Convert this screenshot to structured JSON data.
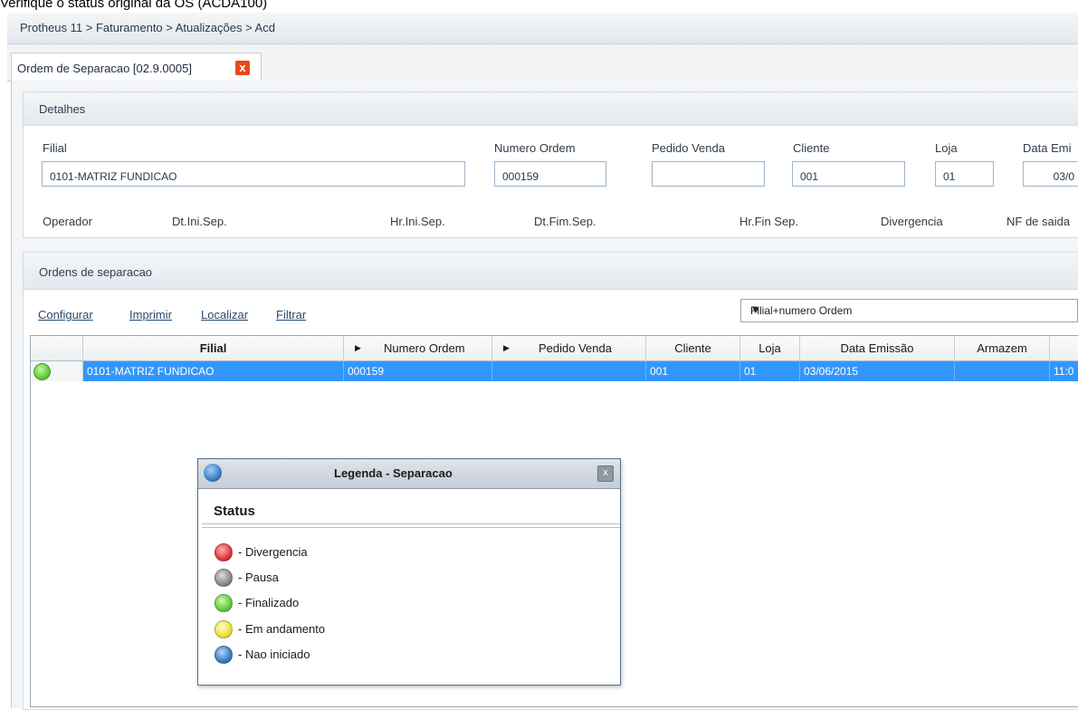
{
  "caption": "Verifique o status original da OS (ACDA100)",
  "breadcrumb": "Protheus 11 > Faturamento > Atualizações > Acd",
  "tab": {
    "label": "Ordem de Separacao [02.9.0005]",
    "close": "x"
  },
  "details": {
    "title": "Detalhes",
    "fields": {
      "filial": {
        "label": "Filial",
        "value": "0101-MATRIZ FUNDICAO"
      },
      "numero_ordem": {
        "label": "Numero Ordem",
        "value": "000159"
      },
      "pedido_venda": {
        "label": "Pedido Venda",
        "value": ""
      },
      "cliente": {
        "label": "Cliente",
        "value": "001"
      },
      "loja": {
        "label": "Loja",
        "value": "01"
      },
      "data_emissao": {
        "label": "Data Emi",
        "value": "03/0"
      }
    },
    "labels_row2": [
      "Operador",
      "Dt.Ini.Sep.",
      "Hr.Ini.Sep.",
      "Dt.Fim.Sep.",
      "Hr.Fin Sep.",
      "Divergencia",
      "NF de saida"
    ]
  },
  "orders": {
    "title": "Ordens de separacao",
    "actions": {
      "configurar": "Configurar",
      "imprimir": "Imprimir",
      "localizar": "Localizar",
      "filtrar": "Filtrar"
    },
    "index_select": {
      "value": "Filial+numero Ordem"
    },
    "columns": [
      "",
      "Filial",
      "Numero Ordem",
      "Pedido Venda",
      "Cliente",
      "Loja",
      "Data Emissão",
      "Armazem",
      ""
    ],
    "rows": [
      {
        "status": "green",
        "filial": "0101-MATRIZ FUNDICAO",
        "numero_ordem": "000159",
        "pedido_venda": "",
        "cliente": "001",
        "loja": "01",
        "data_emissao": "03/06/2015",
        "armazem": "",
        "hora": "11:0"
      }
    ]
  },
  "legend_dialog": {
    "title": "Legenda - Separacao",
    "close": "x",
    "heading": "Status",
    "items": [
      {
        "label": "- Divergencia",
        "color": "#e03c3c"
      },
      {
        "label": "- Pausa",
        "color": "#8c8c8c"
      },
      {
        "label": "- Finalizado",
        "color": "#5fcf3a"
      },
      {
        "label": "- Em andamento",
        "color": "#f1e13a"
      },
      {
        "label": "- Nao iniciado",
        "color": "#3d7fc4"
      }
    ]
  },
  "colors": {
    "selection": "#3297fd",
    "status_green": "#5fcf3a",
    "tab_close": "#e8491d"
  }
}
